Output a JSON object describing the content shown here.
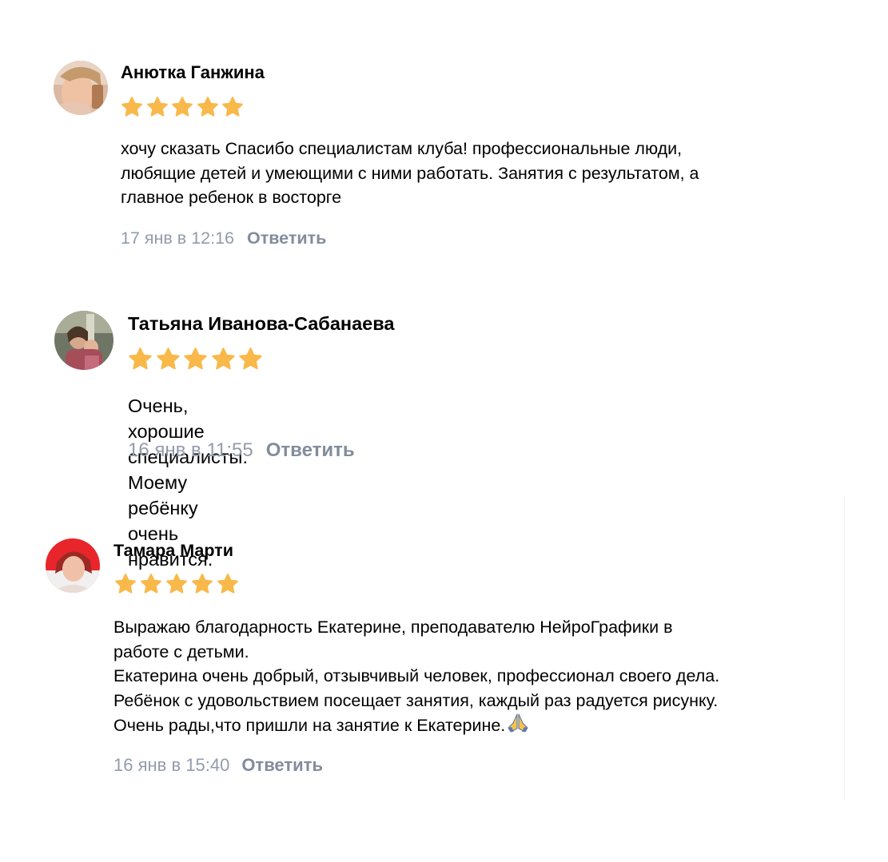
{
  "reviews": [
    {
      "author": "Анютка Ганжина",
      "rating": 5,
      "text": "хочу сказать Спасибо специалистам клуба! профессиональные люди,\nлюбящие детей и умеющими с ними работать. Занятия с результатом, а\nглавное ребенок в восторге",
      "date": "17 янв в 12:16",
      "reply_label": "Ответить"
    },
    {
      "author": "Татьяна Иванова-Сабанаева",
      "rating": 5,
      "text": "Очень, хорошие специалисты. Моему ребёнку очень нравится.",
      "date": "16 янв в 11:55",
      "reply_label": "Ответить"
    },
    {
      "author": "Тамара Марти",
      "rating": 5,
      "text": "Выражаю благодарность Екатерине, преподавателю НейроГрафики в\nработе с детьми.\nЕкатерина очень добрый, отзывчивый человек, профессионал своего дела.\nРебёнок с удовольствием посещает занятия, каждый раз радуется рисунку.\nОчень рады,что пришли на занятие к Екатерине.",
      "emoji": "🙏",
      "date": "16 янв в 15:40",
      "reply_label": "Ответить"
    }
  ],
  "colors": {
    "star": "#f8b94a",
    "date": "#939cab",
    "reply": "#828c9c",
    "text": "#000000"
  },
  "icons": {
    "star": "star-icon",
    "emoji": "folded-hands-icon"
  }
}
